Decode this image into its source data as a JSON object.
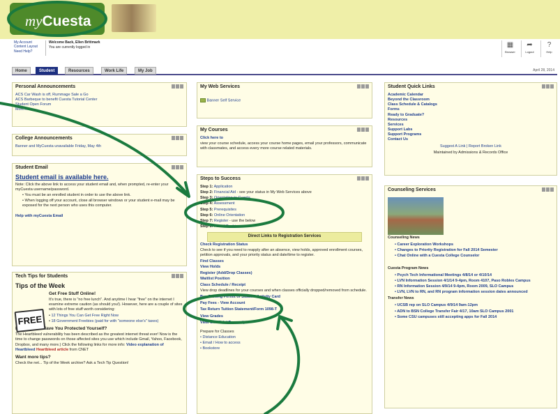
{
  "banner": {
    "logo_prefix": "my",
    "logo_suffix": "Cuesta"
  },
  "user": {
    "links": [
      "My Account",
      "Content Layout",
      "Need Help?"
    ],
    "welcome_label": "Welcome Back, Ellen Brittmark",
    "subtext": "You are currently logged in"
  },
  "toolbar_icons": [
    {
      "icon": "browser-icon",
      "label": "Browser"
    },
    {
      "icon": "logout-icon",
      "label": "Logout"
    },
    {
      "icon": "help-icon",
      "label": "Help"
    }
  ],
  "tabs": [
    "Home",
    "Student",
    "Resources",
    "Work Life",
    "My Job"
  ],
  "date": "April 28, 2014",
  "personal_announcements": {
    "title": "Personal Announcements",
    "items": [
      "ACS Car Wash is off, Rummage Sale a Go",
      "ACS Barbeque to benefit Cuesta Tutorial Center",
      "Student Open Forum"
    ],
    "more": "More..."
  },
  "college_announcements": {
    "title": "College Announcements",
    "line": "Banner and MyCuesta unavailable Friday, May 4th"
  },
  "student_email": {
    "title": "Student Email",
    "headline": "Student email is available here.",
    "note": "Note: Click the above link to access your student email and, when prompted, re-enter your myCuesta username/password.",
    "bullets": [
      "You must be an enrolled student in order to use the above link.",
      "When logging off your account, close all browser windows or your student e-mail may be exposed for the next person who uses this computer."
    ],
    "help_link": "Help with myCuesta Email"
  },
  "tech_tips": {
    "title": "Tech Tips for Students",
    "subtitle": "Tips of the Week",
    "free_label": "FREE",
    "free_title": "Get Free Stuff Online!",
    "free_text": "It's true, there is \"no free lunch\". And anytime I hear \"free\" on the internet I examine extreme caution (as should you!). However, here are a couple of sites with lots of free stuff worth considering:",
    "free_links": [
      "12 Things You Can Get Free Right Now",
      "18 Government Freebies (paid for with \"someone else's\" taxes)"
    ],
    "heartbleed_title": "Heartbleed - Have You Protected Yourself?",
    "heartbleed_text": "The Heartbleed vulnerability has been described as the greatest internet threat ever! Now is the time to change passwords on those affected sites you use which include Gmail, Yahoo, Facebook, Dropbox, and many more.) Click the following links for more info:",
    "heartbleed_links": [
      "Video explanation of Heartbleed",
      "Heartbleed article"
    ],
    "heartbleed_source": "from CNET",
    "more_title": "Want more tips?",
    "more_text": "Check the net... Tip of the Week archive? Ask a Tech Tip Question!"
  },
  "web_services": {
    "title": "My Web Services",
    "item": "Banner Self Service"
  },
  "my_courses": {
    "title": "My Courses",
    "link": "Click here to",
    "text": "view your course schedule, access your course home pages, email your professors, communicate with classmates, and access every more course related materials."
  },
  "steps": {
    "title": "Steps to Success",
    "items": [
      {
        "step": "Step 1:",
        "link": "Application"
      },
      {
        "step": "Step 2:",
        "link": "Financial Aid",
        "extra": "- see your status in My Web Services above"
      },
      {
        "step": "Step 3:",
        "link": "Orientation to Cuesta"
      },
      {
        "step": "Step 4:",
        "link": "Assessment"
      },
      {
        "step": "Step 5:",
        "link": "Prerequisites"
      },
      {
        "step": "Step 6:",
        "link": "Online Orientation"
      },
      {
        "step": "Step 7:",
        "link": "Register",
        "extra": "- use the below"
      },
      {
        "step": "Step 8:",
        "link": "Fees / Cashier"
      }
    ],
    "direct_links_button": "Direct Links to Registration Services",
    "check_status": "Check Registration Status",
    "check_text": "Check to see if you need to reapply after an absence, view holds, approved enrollment courses, petition approvals, and your priority status and date/time to register.",
    "find_classes": "Find Classes",
    "view_holds": "View Holds",
    "register_link": "Register (Add/Drop Classes)",
    "waitlist": "Waitlist Position",
    "class_schedule": "Class Schedule / Receipt",
    "class_schedule_text": "View drop deadlines for your courses and when classes officially dropped/removed from schedule.",
    "parking": "Buy Parking Permit or Student Activity Card",
    "pay_fees": "Pay Fees - View Account",
    "tax_return": "Tax Return Tuition Statement/Form 1098-T",
    "view_grades": "View Grades",
    "transcript": "View Unofficial Transcript",
    "prepare_title": "Prepare for Classes",
    "prepare_items": [
      "Distance Education",
      "Email / How to access",
      "Bookstore"
    ]
  },
  "quick_links": {
    "title": "Student Quick Links",
    "items": [
      "Academic Calendar",
      "Beyond the Classroom",
      "Class Schedule & Catalogs",
      "Forms",
      "Ready to Graduate?",
      "Resources",
      "Services",
      "Support Labs",
      "Support Programs",
      "Contact Us"
    ],
    "suggest": "Suggest A Link | Report Broken Link",
    "maintained": "Maintained by Admissions & Records Office"
  },
  "counseling": {
    "title": "Counseling Services",
    "caption": "Counseling News",
    "news": [
      "Career Exploration Workshops",
      "Changes to Priority Registration for Fall 2014 Semester",
      "Chat Online with a Cuesta College Counselor"
    ],
    "program_title": "Cuesta Program News",
    "program_items": [
      "Psych Tech Informational Meetings 4/8/14 or 4/10/14",
      "LVN Information Session 4/1/14 9-4pm, Room 4107, Paso Robles Campus",
      "RN Information Session 4/9/14 9-4pm, Room 2009, SLO Campus",
      "LVN, LVN to RN, and RN program information session dates announced"
    ],
    "transfer_title": "Transfer News",
    "transfer_items": [
      "UCSB rep on SLO Campus 4/9/14 9am-12pm",
      "ADN to BSN College Transfer Fair 4/17, 10am SLO Campus 2001",
      "Some CSU campuses still accepting apps for Fall 2014"
    ]
  },
  "annotation_color": "#1a7a3e"
}
